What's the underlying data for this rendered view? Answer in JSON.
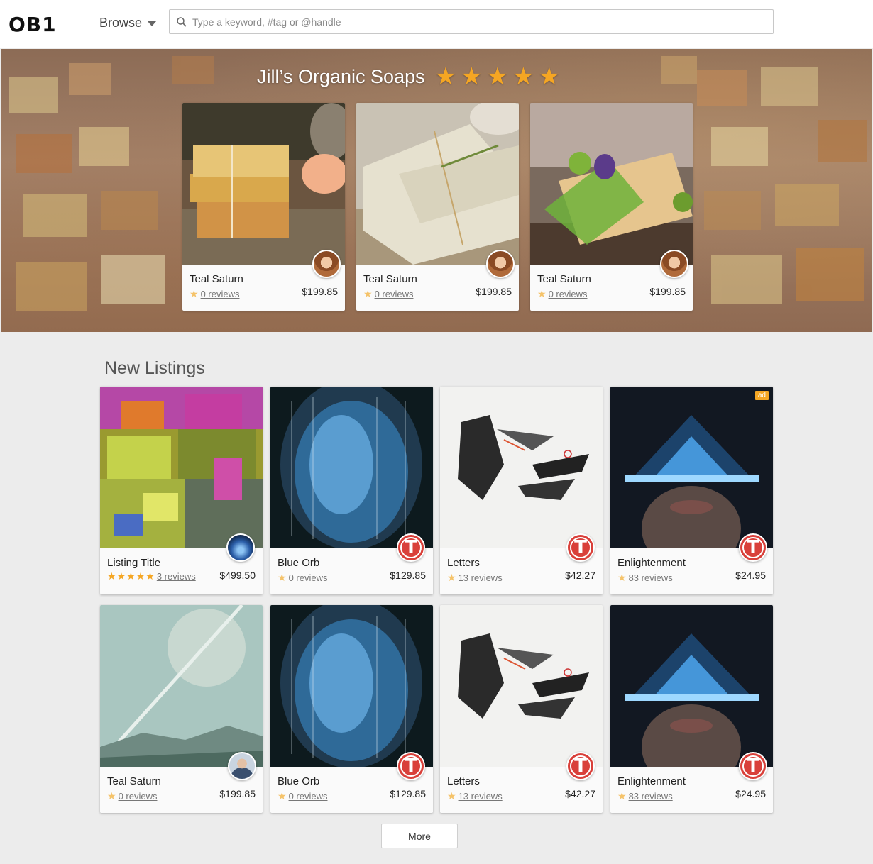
{
  "header": {
    "logo": "OB1",
    "browse_label": "Browse",
    "search_placeholder": "Type a keyword, #tag or @handle"
  },
  "hero": {
    "store_title": "Jill’s Organic Soaps",
    "store_rating": 5,
    "listings": [
      {
        "name": "Teal Saturn",
        "reviews": "0 reviews",
        "price": "$199.85",
        "avatar": "woman-avatar"
      },
      {
        "name": "Teal Saturn",
        "reviews": "0 reviews",
        "price": "$199.85",
        "avatar": "woman-avatar"
      },
      {
        "name": "Teal Saturn",
        "reviews": "0 reviews",
        "price": "$199.85",
        "avatar": "woman-avatar"
      }
    ]
  },
  "new_listings": {
    "title": "New Listings",
    "rows": [
      [
        {
          "name": "Listing Title",
          "stars": 5,
          "reviews": "3 reviews",
          "price": "$499.50",
          "avatar": "orb-avatar",
          "image": "abstract-mosaic"
        },
        {
          "name": "Blue Orb",
          "stars": 1,
          "reviews": "0 reviews",
          "price": "$129.85",
          "avatar": "t-avatar",
          "image": "blue-orb"
        },
        {
          "name": "Letters",
          "stars": 1,
          "reviews": "13 reviews",
          "price": "$42.27",
          "avatar": "t-avatar",
          "image": "ink-letters"
        },
        {
          "name": "Enlightenment",
          "stars": 1,
          "reviews": "83 reviews",
          "price": "$24.95",
          "avatar": "t-avatar",
          "image": "glowing-lips",
          "badge": "ad"
        }
      ],
      [
        {
          "name": "Teal Saturn",
          "stars": 1,
          "reviews": "0 reviews",
          "price": "$199.85",
          "avatar": "man-avatar",
          "image": "planet-landscape"
        },
        {
          "name": "Blue Orb",
          "stars": 1,
          "reviews": "0 reviews",
          "price": "$129.85",
          "avatar": "t-avatar",
          "image": "blue-orb"
        },
        {
          "name": "Letters",
          "stars": 1,
          "reviews": "13 reviews",
          "price": "$42.27",
          "avatar": "t-avatar",
          "image": "ink-letters"
        },
        {
          "name": "Enlightenment",
          "stars": 1,
          "reviews": "83 reviews",
          "price": "$24.95",
          "avatar": "t-avatar",
          "image": "glowing-lips"
        }
      ]
    ],
    "more_label": "More"
  },
  "colors": {
    "star": "#f5a623",
    "t_avatar": "#d9403a",
    "page_bg": "#ececec"
  }
}
